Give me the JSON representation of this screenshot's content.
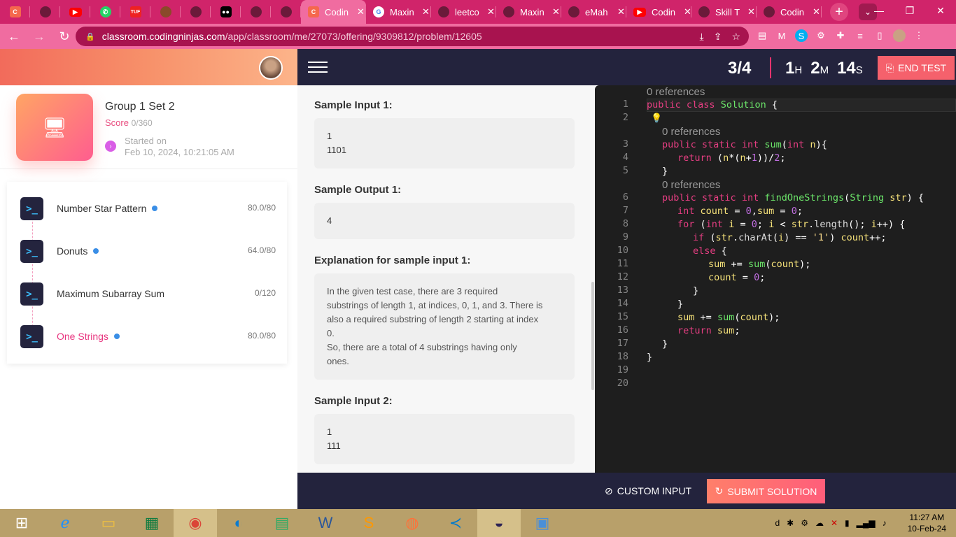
{
  "browser": {
    "tabs": [
      {
        "icon": "cn-icon",
        "color": "#f5684d",
        "label": ""
      },
      {
        "icon": "github-icon",
        "color": "#6b1a3a",
        "label": ""
      },
      {
        "icon": "youtube-icon",
        "color": "#ff0000",
        "label": ""
      },
      {
        "icon": "whatsapp-icon",
        "color": "#25d366",
        "label": ""
      },
      {
        "icon": "tuf-icon",
        "color": "#e22",
        "label": "TUF"
      },
      {
        "icon": "codechef-icon",
        "color": "#8a4a2a",
        "label": ""
      },
      {
        "icon": "github-icon",
        "color": "#6b1a3a",
        "label": ""
      },
      {
        "icon": "medium-icon",
        "color": "#000",
        "label": ""
      },
      {
        "icon": "github-icon",
        "color": "#6b1a3a",
        "label": ""
      },
      {
        "icon": "github-icon",
        "color": "#6b1a3a",
        "label": ""
      }
    ],
    "wide_tabs": [
      {
        "icon": "cn-icon",
        "color": "#f5684d",
        "title": "Codin",
        "close": "✕",
        "active": true
      },
      {
        "icon": "google-icon",
        "color": "#fff",
        "title": "Maxin",
        "close": "✕",
        "active": false
      },
      {
        "icon": "github-icon",
        "color": "#6b1a3a",
        "title": "leetco",
        "close": "✕",
        "active": false
      },
      {
        "icon": "github-icon",
        "color": "#6b1a3a",
        "title": "Maxin",
        "close": "✕",
        "active": false
      },
      {
        "icon": "github-icon",
        "color": "#6b1a3a",
        "title": "eMah",
        "close": "✕",
        "active": false
      },
      {
        "icon": "youtube-icon",
        "color": "#ff0000",
        "title": "Codin",
        "close": "✕",
        "active": false
      },
      {
        "icon": "github-icon",
        "color": "#6b1a3a",
        "title": "Skill T",
        "close": "✕",
        "active": false
      },
      {
        "icon": "github-icon",
        "color": "#6b1a3a",
        "title": "Codin",
        "close": "✕",
        "active": false
      }
    ],
    "new_tab": "+",
    "url_host": "classroom.codingninjas.com",
    "url_path": "/app/classroom/me/27073/offering/9309812/problem/12605"
  },
  "sidebar": {
    "group_title": "Group 1 Set 2",
    "score_label": "Score",
    "score_value": "0/360",
    "started_label": "Started on",
    "started_value": "Feb 10, 2024, 10:21:05 AM",
    "problems": [
      {
        "name": "Number Star Pattern",
        "score": "80.0/80",
        "badge": true,
        "selected": false
      },
      {
        "name": "Donuts",
        "score": "64.0/80",
        "badge": true,
        "selected": false
      },
      {
        "name": "Maximum Subarray Sum",
        "score": "0/120",
        "badge": false,
        "selected": false
      },
      {
        "name": "One Strings",
        "score": "80.0/80",
        "badge": true,
        "selected": true
      }
    ]
  },
  "problem": {
    "sample_input_1_title": "Sample Input 1:",
    "sample_input_1": [
      "1",
      "1101"
    ],
    "sample_output_1_title": "Sample Output 1:",
    "sample_output_1": [
      "4"
    ],
    "explanation_title": "Explanation for sample input 1:",
    "explanation": [
      "In the given test case, there are 3 required",
      "substrings of length 1, at indices, 0, 1, and 3. There is",
      "also a required substring of length 2 starting at index",
      "0.",
      "So, there are a total of 4 substrings having only",
      "ones."
    ],
    "sample_input_2_title": "Sample Input 2:",
    "sample_input_2": [
      "1",
      "111"
    ]
  },
  "header": {
    "question_counter": "3/4",
    "timer": {
      "h": "1",
      "m": "2",
      "s": "14",
      "h_unit": "H",
      "m_unit": "M",
      "s_unit": "S"
    },
    "end_test": "END TEST"
  },
  "editor": {
    "references": "0 references",
    "lines": [
      "1",
      "2",
      "3",
      "4",
      "5",
      "6",
      "7",
      "8",
      "9",
      "10",
      "11",
      "12",
      "13",
      "14",
      "15",
      "16",
      "17",
      "18",
      "19",
      "20"
    ]
  },
  "footer": {
    "custom_input": "CUSTOM INPUT",
    "submit": "SUBMIT SOLUTION"
  },
  "taskbar": {
    "time": "11:27 AM",
    "date": "10-Feb-24",
    "apps": [
      "windows-start-icon",
      "ie-icon",
      "file-explorer-icon",
      "office-icon",
      "chrome-icon",
      "edge-icon",
      "notepad-icon",
      "word-icon",
      "sublime-icon",
      "firefox-icon",
      "vscode-icon",
      "eclipse-icon",
      "photos-icon"
    ]
  }
}
